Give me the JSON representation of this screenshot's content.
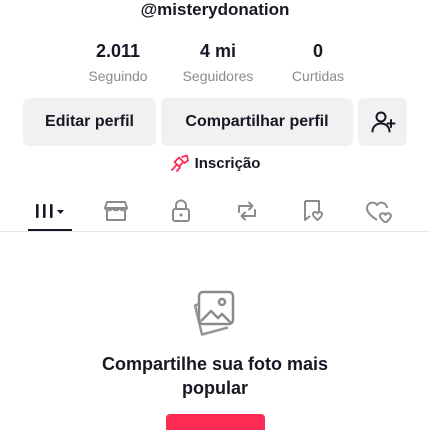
{
  "profile": {
    "username": "@misterydonation"
  },
  "stats": [
    {
      "value": "2.011",
      "label": "Seguindo"
    },
    {
      "value": "4 mi",
      "label": "Seguidores"
    },
    {
      "value": "0",
      "label": "Curtidas"
    }
  ],
  "actions": {
    "edit_label": "Editar perfil",
    "share_label": "Compartilhar perfil",
    "add_friend_icon": "person-plus-icon"
  },
  "subscription": {
    "label": "Inscrição",
    "icon": "subscription-icon",
    "icon_color": "#fe2c55"
  },
  "tabs": [
    {
      "icon": "grid-icon",
      "active": true
    },
    {
      "icon": "shop-icon"
    },
    {
      "icon": "lock-icon"
    },
    {
      "icon": "repost-icon"
    },
    {
      "icon": "favorites-icon"
    },
    {
      "icon": "liked-icon"
    }
  ],
  "empty_state": {
    "icon": "photo-icon",
    "line1": "Compartilhe sua foto mais",
    "line2": "popular"
  },
  "colors": {
    "accent": "#fe2c55",
    "text_primary": "#161823",
    "text_secondary": "#8a8b91",
    "button_bg": "#f1f1f2"
  }
}
